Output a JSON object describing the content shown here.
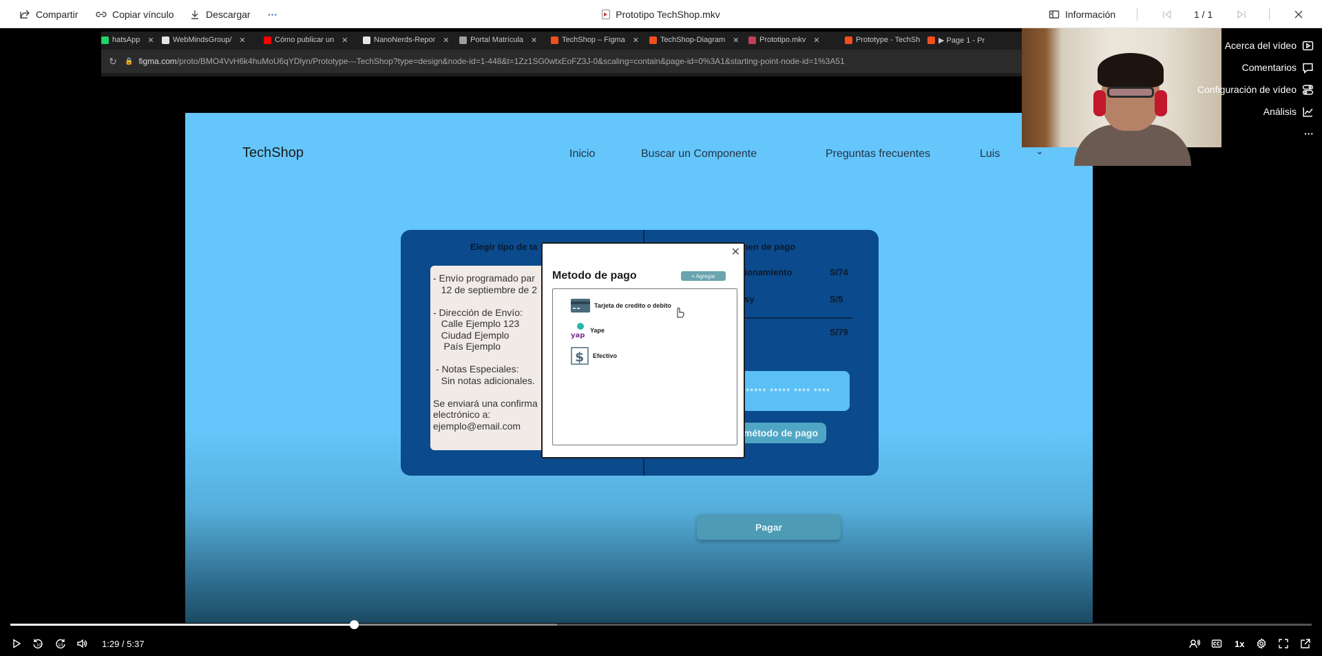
{
  "topbar": {
    "share_label": "Compartir",
    "copy_link_label": "Copiar vínculo",
    "download_label": "Descargar",
    "more_label": "···",
    "file_title": "Prototipo TechShop.mkv",
    "info_label": "Información",
    "page_counter": "1 / 1"
  },
  "side_menu": {
    "items": [
      {
        "label": "Acerca del vídeo",
        "icon": "play-box-icon"
      },
      {
        "label": "Comentarios",
        "icon": "comment-icon"
      },
      {
        "label": "Configuración de vídeo",
        "icon": "settings-toggle-icon"
      },
      {
        "label": "Análisis",
        "icon": "analytics-icon"
      }
    ],
    "more_label": "···"
  },
  "browser": {
    "tabs": [
      {
        "label": "hatsApp",
        "color": "#25d366"
      },
      {
        "label": "WebMindsGroup/",
        "color": "#e6e6e6"
      },
      {
        "label": "Cómo publicar un",
        "color": "#ff0000"
      },
      {
        "label": "NanoNerds-Repor",
        "color": "#e6e6e6"
      },
      {
        "label": "Portal Matrícula",
        "color": "#9aa0a6"
      },
      {
        "label": "TechShop – Figma",
        "color": "#f24e1e"
      },
      {
        "label": "TechShop-Diagram",
        "color": "#f24e1e"
      },
      {
        "label": "Prototipo.mkv",
        "color": "#c43e5a"
      },
      {
        "label": "Prototype - TechSh",
        "color": "#f24e1e"
      },
      {
        "label": "▶ Page 1 - Pr",
        "color": "#f24e1e"
      }
    ],
    "close_glyph": "✕",
    "url_host": "figma.com",
    "url_path": "/proto/BMO4VvH6k4huMoU6qYDlyn/Prototype---TechShop?type=design&node-id=1-448&t=1Zz1SG0wtxEoFZ3J-0&scaling=contain&page-id=0%3A1&starting-point-node-id=1%3A51"
  },
  "prototype": {
    "logo": "TechShop",
    "nav": [
      "Inicio",
      "Buscar un Componente",
      "Preguntas frecuentes",
      "Luis"
    ],
    "left_header": "Elegir tipo de ta",
    "right_header": "men de pago",
    "notes_text": "- Envío programado par\n   12 de septiembre de 2\n\n- Dirección de Envío:\n   Calle Ejemplo 123\n   Ciudad Ejemplo\n    País Ejemplo\n\n - Notas Especiales:\n   Sin notas adicionales.\n\nSe enviará una confirma\nelectrónico a:\nejemplo@email.com",
    "summary": [
      {
        "label": "cionamiento",
        "value": "S/74"
      },
      {
        "label": "asy",
        "value": "S/5"
      }
    ],
    "total_value": "S/79",
    "card_label": "o",
    "card_masked": "***** ***** **** ****",
    "select_method_label": "ar método de pago",
    "pay_label": "Pagar"
  },
  "modal": {
    "close": "✕",
    "title": "Metodo de pago",
    "add_label": "+ Agregar",
    "options": [
      {
        "label": "Tarjeta de credito o debito",
        "icon": "credit-card-icon"
      },
      {
        "label": "Yape",
        "icon": "yape-icon"
      },
      {
        "label": "Efectivo",
        "icon": "dollar-icon"
      }
    ]
  },
  "player": {
    "time": "1:29 / 5:37",
    "progress": 0.264,
    "buffered": 0.42,
    "speed": "1x"
  },
  "colors": {
    "prototype_bg": "#64c6fb",
    "card_bg": "#0b4a8c",
    "pay_button": "#4d9bb5"
  }
}
